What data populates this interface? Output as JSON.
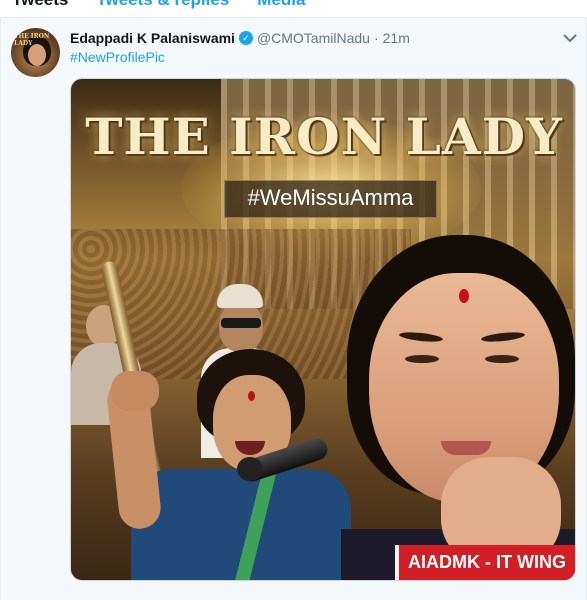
{
  "tabs": [
    {
      "label": "Tweets",
      "active": true
    },
    {
      "label": "Tweets & replies",
      "active": false
    },
    {
      "label": "Media",
      "active": false
    }
  ],
  "tweet": {
    "author_name": "Edappadi K Palaniswami",
    "verified_icon": "verified-badge-icon",
    "handle": "@CMOTamilNadu",
    "separator": "·",
    "time": "21m",
    "text_hashtag": "#NewProfilePic",
    "caret_icon": "chevron-down-icon",
    "avatar_caption": "THE IRON LADY"
  },
  "media": {
    "title": "THE IRON LADY",
    "hashtag": "#WeMissuAmma",
    "badge": "AIADMK - IT WING"
  },
  "colors": {
    "link_blue": "#1da1f2",
    "badge_red": "#d21f26",
    "text_dark": "#14171a",
    "text_gray": "#657786"
  }
}
